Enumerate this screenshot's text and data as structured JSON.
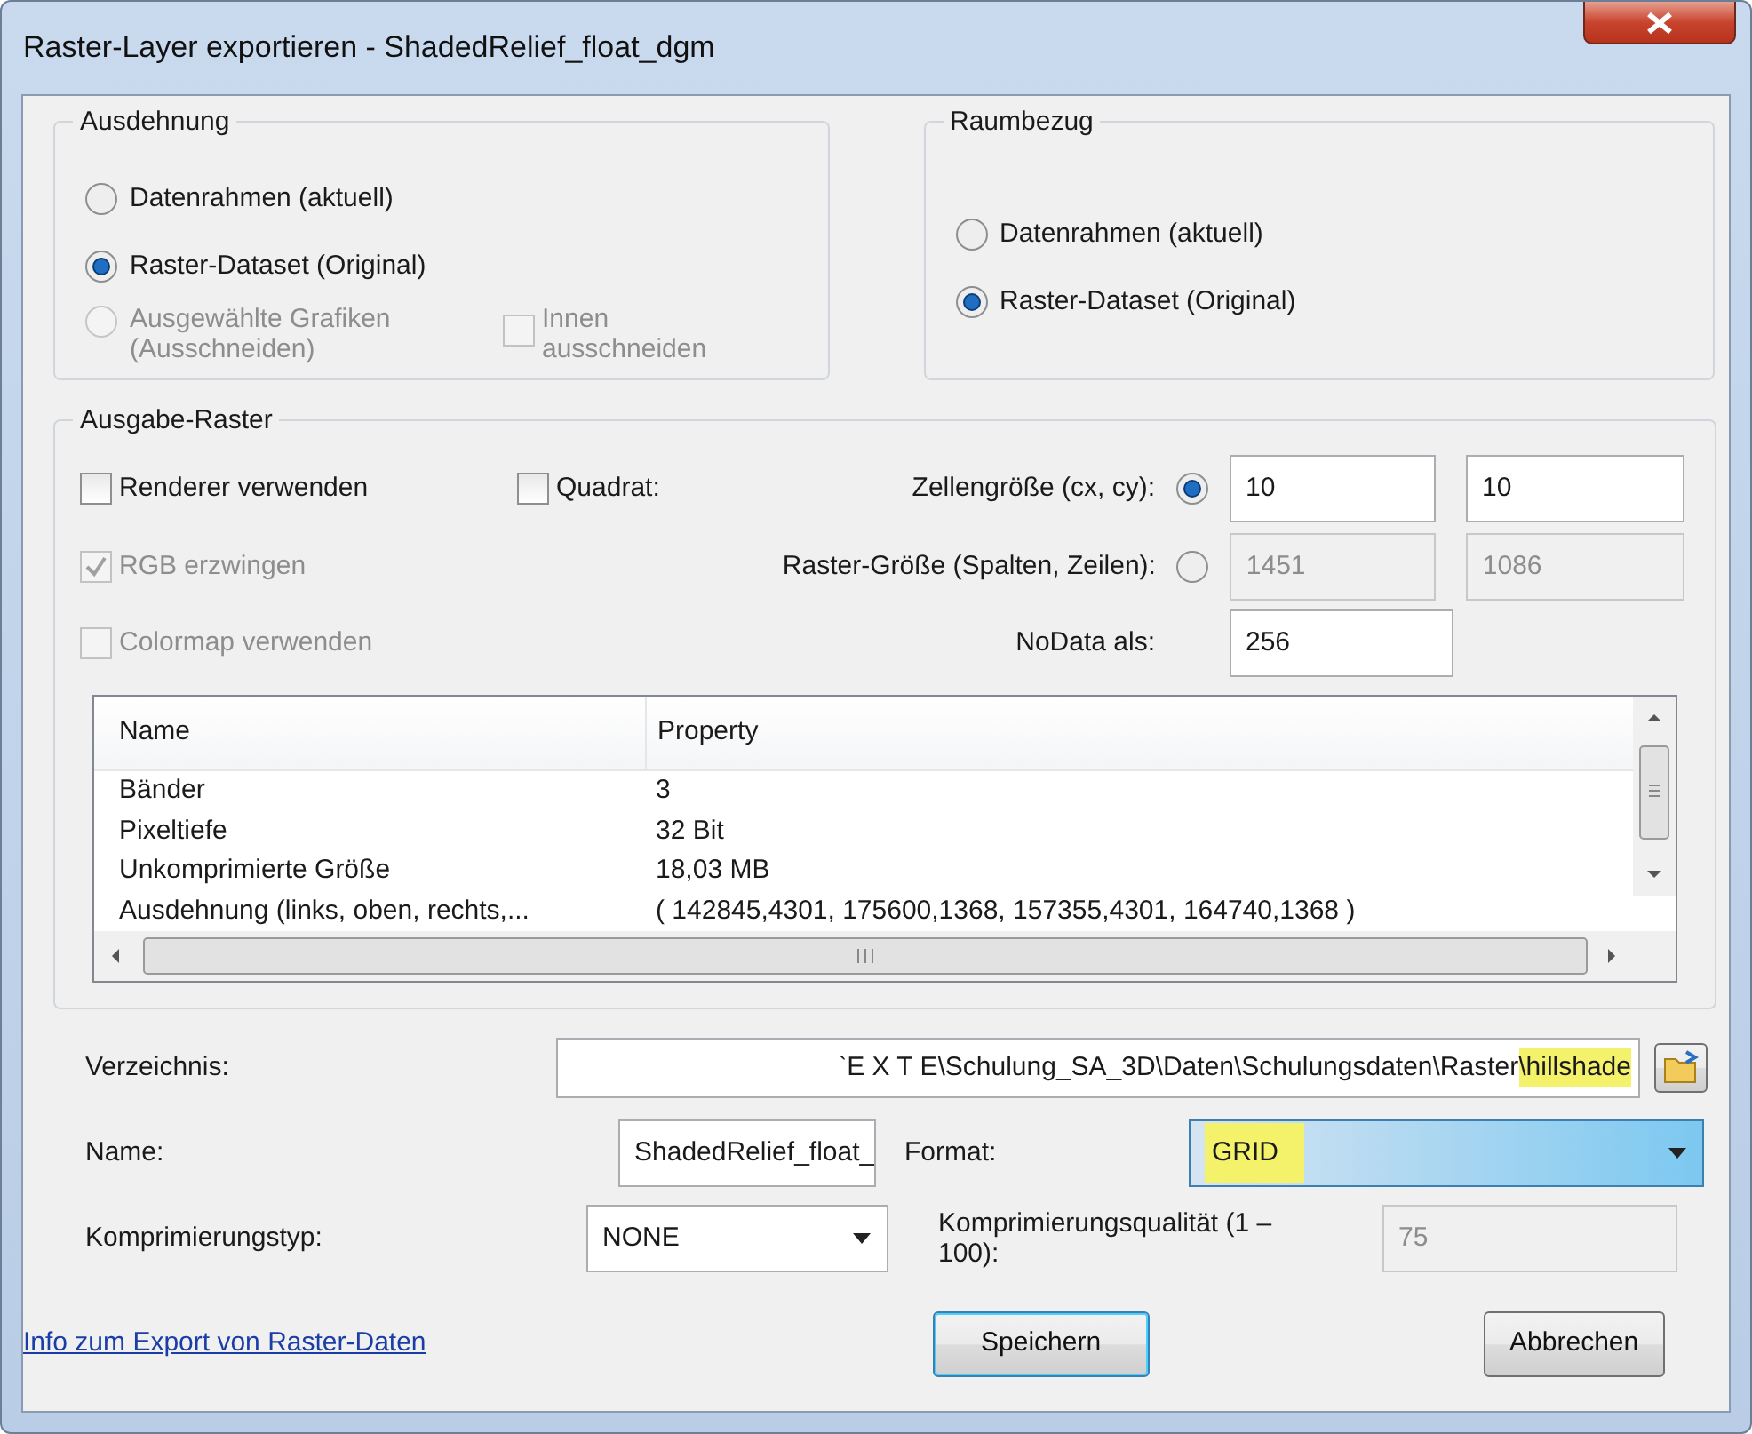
{
  "window": {
    "title": "Raster-Layer exportieren - ShadedRelief_float_dgm"
  },
  "extent": {
    "legend": "Ausdehnung",
    "options": [
      {
        "label": "Datenrahmen (aktuell)",
        "selected": false,
        "disabled": false
      },
      {
        "label": "Raster-Dataset (Original)",
        "selected": true,
        "disabled": false
      },
      {
        "label": "Ausgewählte Grafiken (Ausschneiden)",
        "selected": false,
        "disabled": true
      }
    ],
    "clip": {
      "label": "Innen ausschneiden",
      "checked": false,
      "disabled": true
    }
  },
  "spatial_reference": {
    "legend": "Raumbezug",
    "options": [
      {
        "label": "Datenrahmen (aktuell)",
        "selected": false,
        "disabled": false
      },
      {
        "label": "Raster-Dataset (Original)",
        "selected": true,
        "disabled": false
      }
    ]
  },
  "output": {
    "legend": "Ausgabe-Raster",
    "rows": [
      {
        "checkbox": {
          "label": "Renderer verwenden",
          "checked": false,
          "disabled": false
        },
        "extra_checkbox": {
          "label": "Quadrat:",
          "checked": false,
          "disabled": false
        },
        "label": "Zellengröße (cx, cy):",
        "radio_selected": true,
        "fields": [
          {
            "value": "10",
            "disabled": false
          },
          {
            "value": "10",
            "disabled": false
          }
        ]
      },
      {
        "checkbox": {
          "label": "RGB erzwingen",
          "checked": true,
          "disabled": true
        },
        "label": "Raster-Größe (Spalten, Zeilen):",
        "radio_selected": false,
        "fields": [
          {
            "value": "1451",
            "disabled": true
          },
          {
            "value": "1086",
            "disabled": true
          }
        ]
      },
      {
        "checkbox": {
          "label": "Colormap verwenden",
          "checked": false,
          "disabled": true
        },
        "label": "NoData als:",
        "fields": [
          {
            "value": "256",
            "disabled": false
          }
        ]
      }
    ],
    "table": {
      "columns": [
        "Name",
        "Property"
      ],
      "rows": [
        [
          "Bänder",
          "3"
        ],
        [
          "Pixeltiefe",
          "32 Bit"
        ],
        [
          "Unkomprimierte Größe",
          "18,03 MB"
        ],
        [
          "Ausdehnung (links, oben, rechts,...",
          "( 142845,4301, 175600,1368, 157355,4301, 164740,1368 )"
        ]
      ]
    }
  },
  "directory": {
    "label": "Verzeichnis:",
    "value_parts": [
      {
        "text": "`E X T E\\Schulung_SA_3D\\Daten\\Schulungsdaten\\Raster",
        "highlighted": false
      },
      {
        "text": "\\hillshade",
        "highlighted": true
      }
    ]
  },
  "name": {
    "label": "Name:",
    "value": "ShadedRelief_float_"
  },
  "format": {
    "label": "Format:",
    "value": "GRID",
    "highlighted": true,
    "focused": true
  },
  "compression_type": {
    "label": "Komprimierungstyp:",
    "value": "NONE"
  },
  "compression_quality": {
    "label": "Komprimierungsqualität (1 – 100):",
    "value": "75",
    "disabled": true
  },
  "help_link": "Info zum Export von Raster-Daten",
  "buttons": [
    {
      "label": "Speichern",
      "default": true
    },
    {
      "label": "Abbrechen",
      "default": false
    }
  ]
}
